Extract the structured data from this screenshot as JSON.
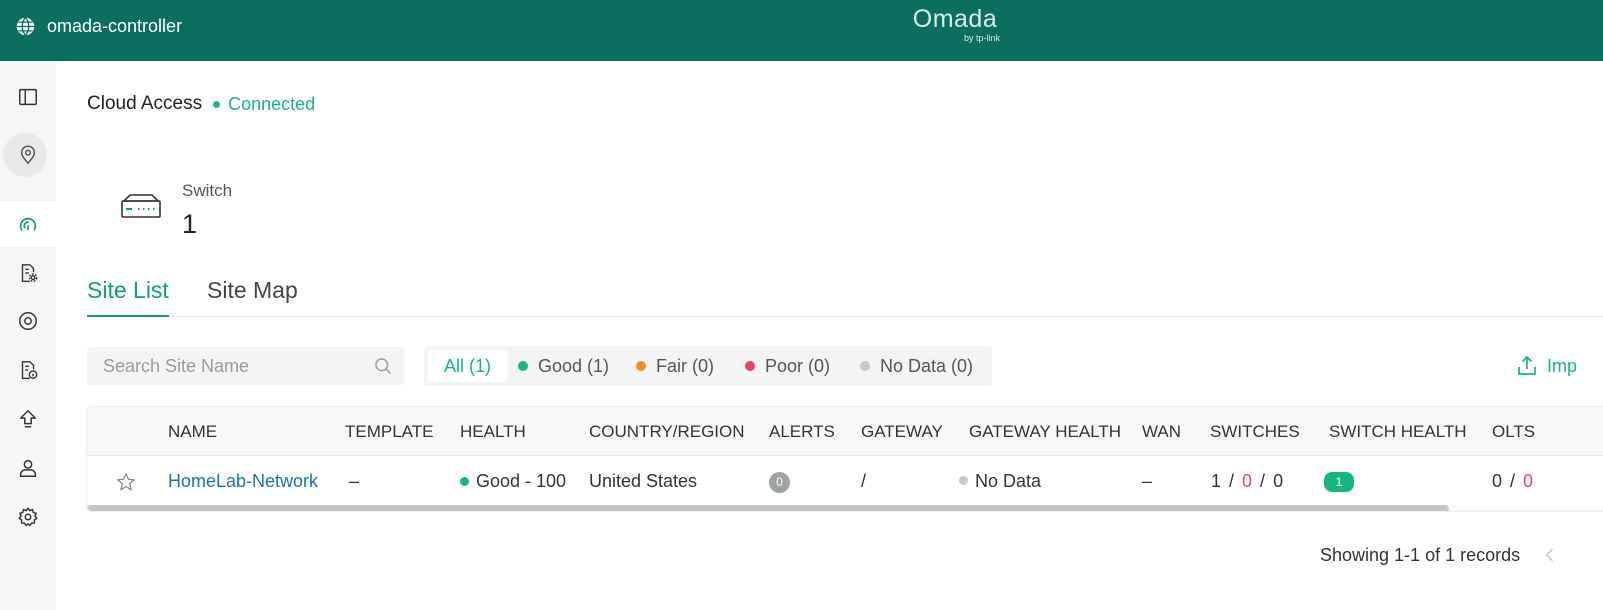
{
  "header": {
    "app_title": "omada-controller",
    "logo_text": "Omada",
    "logo_sub": "by tp-link"
  },
  "sidebar": {
    "items": [
      {
        "name": "toggle-sidebar",
        "icon": "panel-icon"
      },
      {
        "name": "site-location",
        "icon": "location-pin-icon"
      },
      {
        "name": "dashboard",
        "icon": "dashboard-gauge-icon"
      },
      {
        "name": "device-settings",
        "icon": "file-settings-icon"
      },
      {
        "name": "monitor",
        "icon": "target-circle-icon"
      },
      {
        "name": "logs",
        "icon": "file-info-icon"
      },
      {
        "name": "upgrade",
        "icon": "arrow-up-icon"
      },
      {
        "name": "accounts",
        "icon": "user-icon"
      },
      {
        "name": "settings",
        "icon": "gear-icon"
      }
    ]
  },
  "cloud": {
    "title": "Cloud Access",
    "status": "Connected"
  },
  "device_summary": {
    "label": "Switch",
    "count": "1"
  },
  "tabs": [
    {
      "label": "Site List",
      "active": true
    },
    {
      "label": "Site Map",
      "active": false
    }
  ],
  "search": {
    "placeholder": "Search Site Name",
    "value": ""
  },
  "filters": [
    {
      "label": "All (1)",
      "active": true,
      "color": ""
    },
    {
      "label": "Good (1)",
      "active": false,
      "color": "#16b67e"
    },
    {
      "label": "Fair (0)",
      "active": false,
      "color": "#f08c2d"
    },
    {
      "label": "Poor (0)",
      "active": false,
      "color": "#e5455f"
    },
    {
      "label": "No Data (0)",
      "active": false,
      "color": "#c8c8c8"
    }
  ],
  "import_label": "Imp",
  "table": {
    "columns": [
      "NAME",
      "TEMPLATE",
      "HEALTH",
      "COUNTRY/REGION",
      "ALERTS",
      "GATEWAY",
      "GATEWAY HEALTH",
      "WAN",
      "SWITCHES",
      "SWITCH HEALTH",
      "OLTS"
    ],
    "rows": [
      {
        "name": "HomeLab-Network",
        "template": "–",
        "health": "Good - 100",
        "country": "United States",
        "alerts": "0",
        "gateway": "/",
        "gateway_health": "No Data",
        "wan": "–",
        "switches": [
          "1",
          "0",
          "0"
        ],
        "switch_health": "1",
        "olts": [
          "0",
          "0"
        ]
      }
    ]
  },
  "pagination": {
    "summary": "Showing 1-1 of 1 records"
  },
  "colors": {
    "brand": "#0b6e5f",
    "accent": "#16b67e",
    "link": "#1e6fb8",
    "danger": "#e5455f"
  }
}
